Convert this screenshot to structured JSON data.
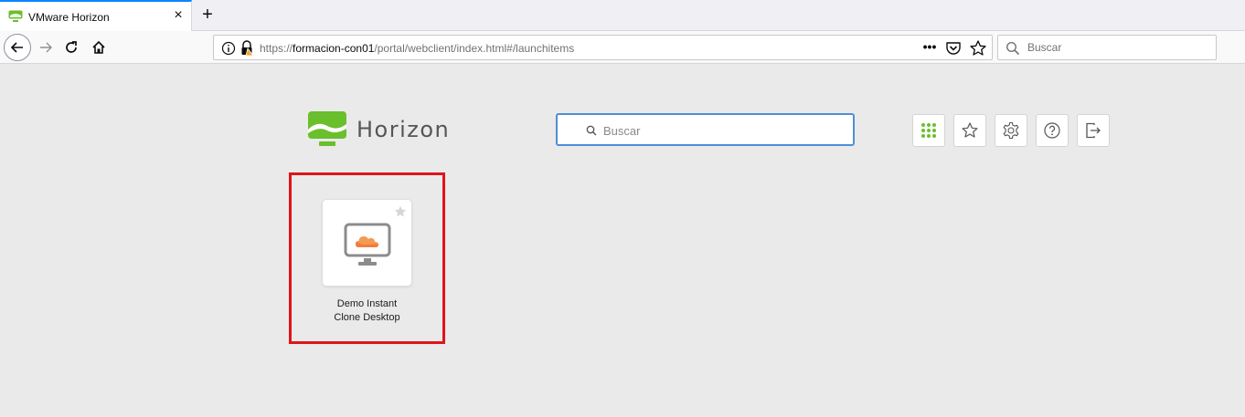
{
  "browser": {
    "tab_title": "VMware Horizon",
    "close_tab_glyph": "×",
    "new_tab_glyph": "+",
    "url_scheme": "https://",
    "url_host": "formacion-con01",
    "url_path": "/portal/webclient/index.html#/launchitems",
    "page_actions_glyph": "•••",
    "search_placeholder": "Buscar",
    "accent_color": "#0a84ff",
    "icons": [
      "back-icon",
      "forward-icon",
      "reload-icon",
      "home-icon",
      "info-icon",
      "insecure-lock-icon",
      "page-actions-icon",
      "pocket-icon",
      "bookmark-star-icon",
      "search-icon"
    ]
  },
  "portal": {
    "logo_text": "Horizon",
    "search_placeholder": "Buscar",
    "toolbar_icons": [
      "apps-grid-icon",
      "favorites-star-icon",
      "settings-gear-icon",
      "help-icon",
      "logout-icon"
    ],
    "brand_color": "#6abf2c",
    "highlight_color": "#e0141a",
    "apps": [
      {
        "name_line1": "Demo Instant",
        "name_line2": "Clone Desktop",
        "icon": "desktop-cloud-icon",
        "favorite": false
      }
    ]
  }
}
